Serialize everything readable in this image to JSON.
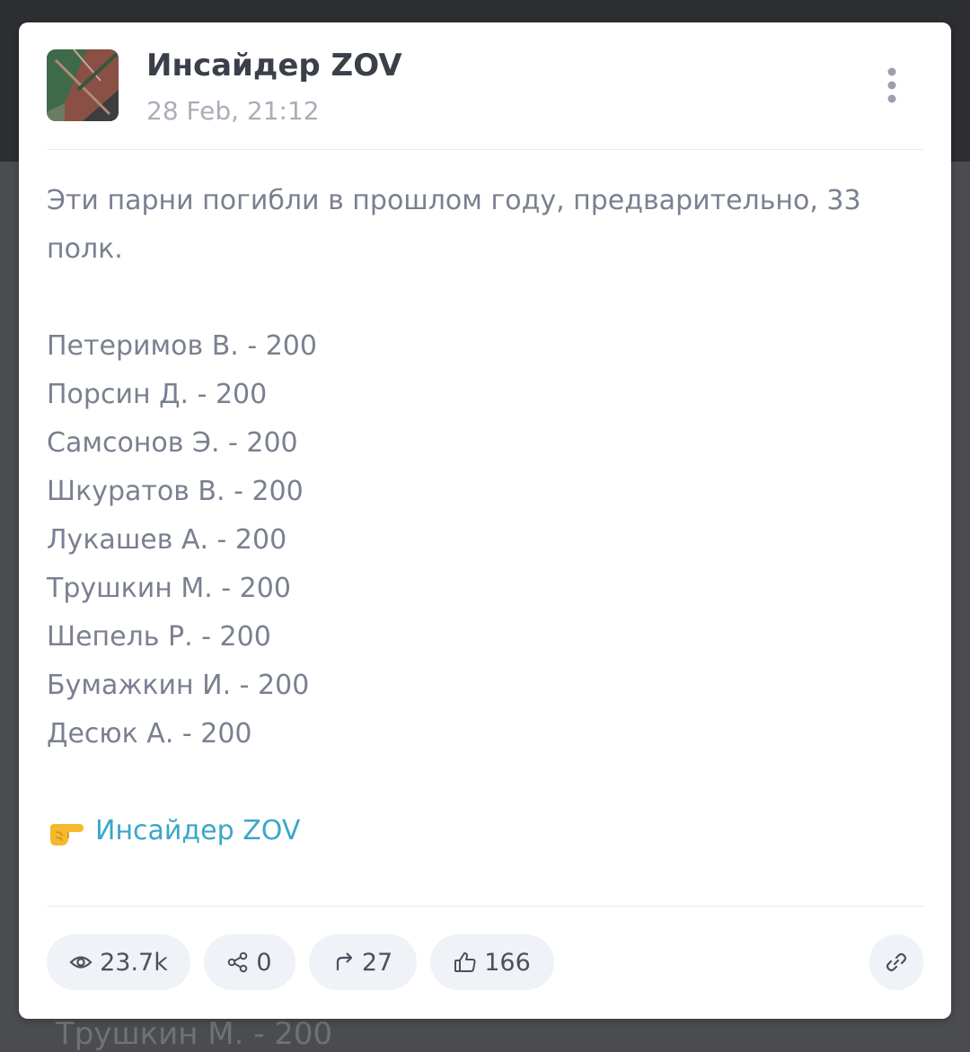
{
  "backdrop": {
    "partial_text": "Трушкин М. - 200"
  },
  "post": {
    "channel_name": "Инсайдер ZOV",
    "date": "28 Feb, 21:12",
    "intro_text": "Эти парни погибли в прошлом году, предварительно, 33 полк.",
    "roster": [
      "Петеримов В. - 200",
      "Порсин Д. - 200",
      "Самсонов Э. - 200",
      "Шкуратов В. - 200",
      "Лукашев А. - 200",
      "Трушкин М. - 200",
      "Шепель Р. - 200",
      "Бумажкин И. - 200",
      "Десюк А. - 200"
    ],
    "signature_link": "Инсайдер ZOV"
  },
  "stats": {
    "views": "23.7k",
    "comments": "0",
    "shares": "27",
    "likes": "166"
  },
  "icons": {
    "more": "vertical-dots-icon",
    "views": "eye-icon",
    "comments": "share-nodes-icon",
    "shares": "forward-arrow-icon",
    "likes": "thumbs-up-icon",
    "link": "chain-link-icon",
    "pointer": "backhand-index-pointing-right-emoji"
  },
  "colors": {
    "link": "#3ba6c9",
    "text": "#7a8090",
    "title": "#3a3f49",
    "muted": "#a9aeb8",
    "pill_bg": "#eff2f6"
  }
}
